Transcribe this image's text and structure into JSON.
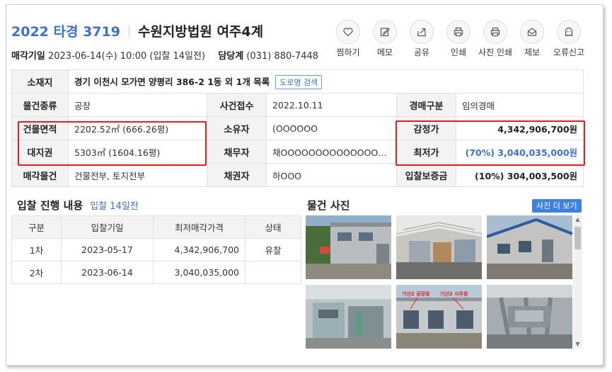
{
  "header": {
    "case_no": "2022 타경 3719",
    "court": "수원지방법원 여주4계",
    "sale_date_label": "매각기일",
    "sale_date_value": "2023-06-14(수) 10:00 (입찰 14일전)",
    "dept_label": "담당계",
    "dept_value": "(031) 880-7448"
  },
  "actions": [
    {
      "label": "찜하기",
      "icon": "heart-icon"
    },
    {
      "label": "메모",
      "icon": "memo-icon"
    },
    {
      "label": "공유",
      "icon": "share-icon"
    },
    {
      "label": "인쇄",
      "icon": "print-icon"
    },
    {
      "label": "사진 인쇄",
      "icon": "photo-print-icon"
    },
    {
      "label": "제보",
      "icon": "mail-icon"
    },
    {
      "label": "오류신고",
      "icon": "ghost-icon"
    }
  ],
  "info": {
    "location_label": "소재지",
    "location_value": "경기 이천시 모가면 양평리 386-2 1동 외 1개 목록",
    "road_btn": "도로명 검색",
    "type_label": "물건종류",
    "type_value": "공장",
    "received_label": "사건접수",
    "received_value": "2022.10.11",
    "auction_label": "경매구분",
    "auction_value": "임의경매",
    "bldg_area_label": "건물면적",
    "bldg_area_value": "2202.52㎡ (666.26평)",
    "owner_label": "소유자",
    "owner_value": "(OOOOOO",
    "appraisal_label": "감정가",
    "appraisal_value": "4,342,906,700원",
    "land_label": "대지권",
    "land_value": "5303㎡ (1604.16평)",
    "debtor_label": "채무자",
    "debtor_value": "채OOOOOOOOOOOOOOOOO",
    "min_label": "최저가",
    "min_value": "(70%) 3,040,035,000원",
    "sale_item_label": "매각물건",
    "sale_item_value": "건물전부, 토지전부",
    "creditor_label": "채권자",
    "creditor_value": "하OOO",
    "deposit_label": "입찰보증금",
    "deposit_value": "(10%) 304,003,500원"
  },
  "bid_section": {
    "title": "입찰 진행 내용",
    "sub": "입찰 14일전",
    "headers": [
      "구분",
      "입찰기일",
      "최저매각가격",
      "상태"
    ],
    "rows": [
      {
        "round": "1차",
        "date": "2023-05-17",
        "price": "4,342,906,700",
        "status": "유찰"
      },
      {
        "round": "2차",
        "date": "2023-06-14",
        "price": "3,040,035,000",
        "status": ""
      }
    ]
  },
  "photo_section": {
    "title": "물건 사진",
    "more_btn": "사진 더 보기",
    "photo_texts": [
      "기산2 공장동",
      "기산2 사무동"
    ]
  }
}
